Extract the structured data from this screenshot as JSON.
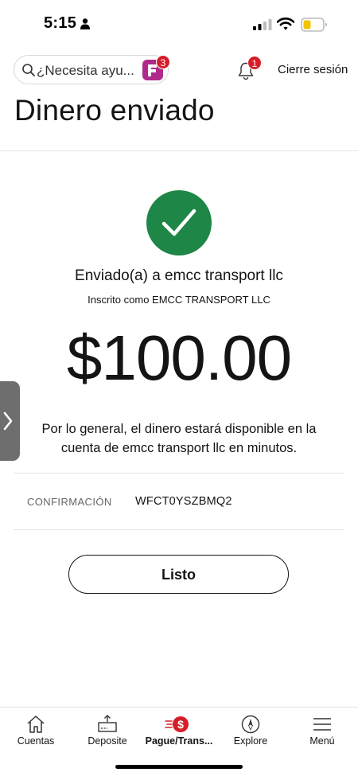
{
  "status_bar": {
    "time": "5:15"
  },
  "header": {
    "search_placeholder": "¿Necesita ayu...",
    "search_badge": "3",
    "notification_badge": "1",
    "logout_label": "Cierre sesión"
  },
  "page": {
    "title": "Dinero enviado"
  },
  "confirmation": {
    "recipient_line": "Enviado(a) a emcc transport llc",
    "enrolled_line": "Inscrito como EMCC TRANSPORT LLC",
    "amount": "$100.00",
    "availability_text": "Por lo general, el dinero estará disponible en la cuenta de emcc transport llc en minutos.",
    "confirmation_label": "CONFIRMACIÓN",
    "confirmation_code": "WFCT0YSZBMQ2",
    "done_button": "Listo"
  },
  "bottom_nav": {
    "items": [
      {
        "label": "Cuentas",
        "icon": "home-icon"
      },
      {
        "label": "Deposite",
        "icon": "deposit-icon"
      },
      {
        "label": "Pague/Trans...",
        "icon": "pay-transfer-icon",
        "active": true
      },
      {
        "label": "Explore",
        "icon": "compass-icon"
      },
      {
        "label": "Menú",
        "icon": "menu-icon"
      }
    ]
  },
  "colors": {
    "success_green": "#1e8646",
    "badge_red": "#d71e28",
    "side_tab_gray": "#6e6e6e"
  }
}
